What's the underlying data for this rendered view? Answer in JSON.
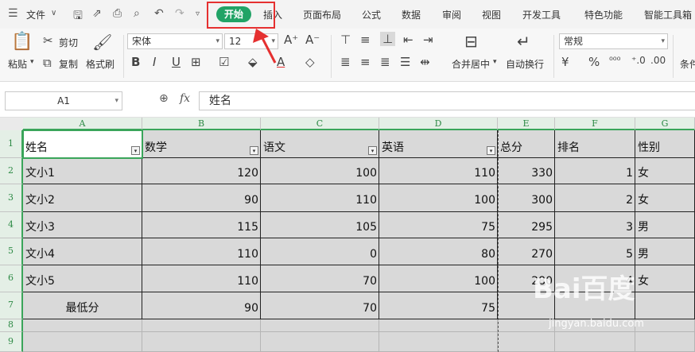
{
  "menu": {
    "file_label": "文件",
    "tabs": [
      "开始",
      "插入",
      "页面布局",
      "公式",
      "数据",
      "审阅",
      "视图",
      "开发工具",
      "特色功能",
      "智能工具箱"
    ]
  },
  "ribbon": {
    "paste": "粘贴",
    "cut": "剪切",
    "copy": "复制",
    "format_painter": "格式刷",
    "font_name": "宋体",
    "font_size": "12",
    "merge_center": "合并居中",
    "auto_wrap": "自动换行",
    "number_format": "常规",
    "conditional": "条件"
  },
  "formula_bar": {
    "name_box": "A1",
    "fx": "fx",
    "content": "姓名"
  },
  "sheet": {
    "columns": [
      "A",
      "B",
      "C",
      "D",
      "E",
      "F",
      "G"
    ],
    "row_numbers": [
      "1",
      "2",
      "3",
      "4",
      "5",
      "6",
      "7",
      "8",
      "9"
    ],
    "headers": [
      "姓名",
      "数学",
      "语文",
      "英语",
      "总分",
      "排名",
      "性别"
    ],
    "rows": [
      [
        "文小1",
        "120",
        "100",
        "110",
        "330",
        "1",
        "女"
      ],
      [
        "文小2",
        "90",
        "110",
        "100",
        "300",
        "2",
        "女"
      ],
      [
        "文小3",
        "115",
        "105",
        "75",
        "295",
        "3",
        "男"
      ],
      [
        "文小4",
        "110",
        "0",
        "80",
        "270",
        "5",
        "男"
      ],
      [
        "文小5",
        "110",
        "70",
        "100",
        "280",
        "4",
        "女"
      ],
      [
        "最低分",
        "90",
        "70",
        "75",
        "",
        "",
        ""
      ]
    ]
  },
  "watermark": {
    "brand": "Bai百度",
    "site": "jingyan.baidu.com"
  },
  "colors": {
    "accent_green": "#21a366",
    "highlight_red": "#e53030",
    "selection_green": "#3aa55a"
  }
}
